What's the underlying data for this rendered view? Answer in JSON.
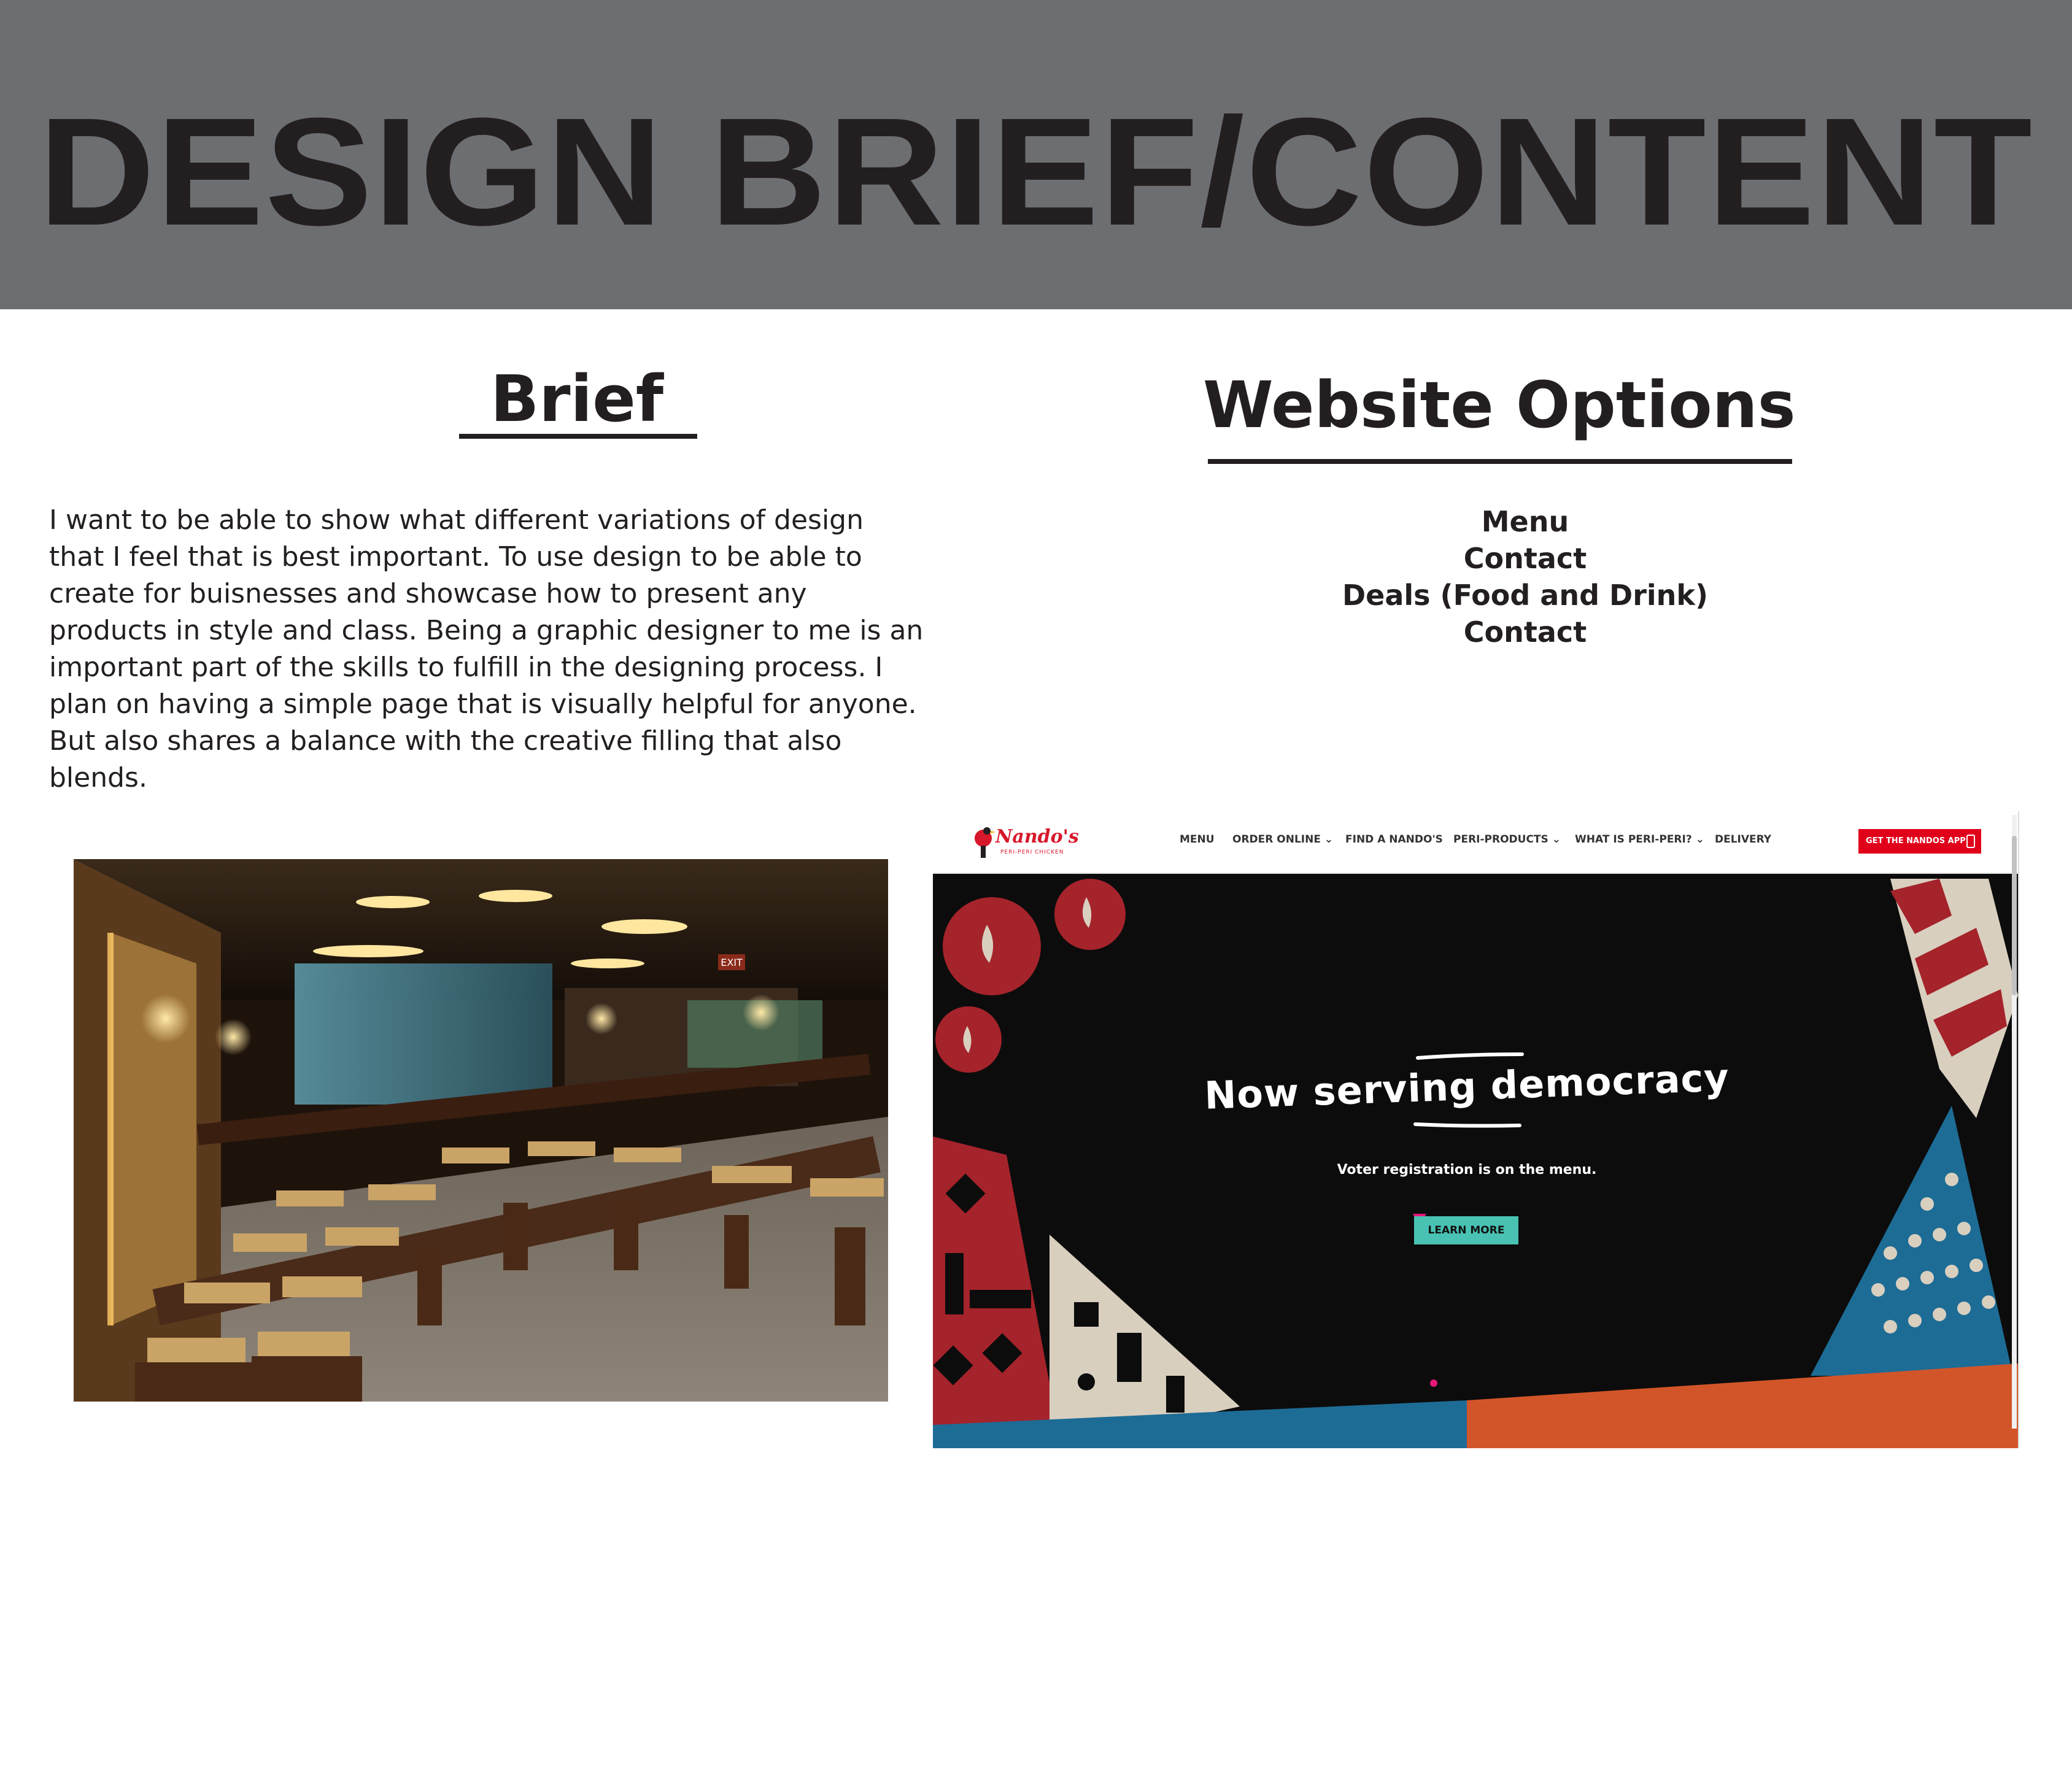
{
  "header": {
    "title": "DESIGN BRIEF/CONTENT",
    "background": "#6d6e71"
  },
  "brief": {
    "title": "Brief",
    "text": "I want to be able to show what different variations of design that I feel that is best important. To use design to be able to create for buisnesses and showcase how to present any products in style and class. Being a graphic designer to me is an important part of the skills to fulfill in the designing process. I plan on having a simple page that is visually helpful for anyone. But also shares a balance with the creative filling that also blends."
  },
  "website_options": {
    "title": "Website Options",
    "items": [
      "Menu",
      "Contact",
      "Deals (Food and Drink)",
      "Contact"
    ]
  },
  "restaurant_photo": {
    "icon": "restaurant-interior-photo",
    "exit_sign": "EXIT"
  },
  "site_screenshot": {
    "logo": "Nando's",
    "logo_tagline": "PERI-PERI CHICKEN",
    "nav": [
      "MENU",
      "ORDER ONLINE ⌄",
      "FIND A NANDO'S",
      "PERI-PRODUCTS ⌄",
      "WHAT IS PERI-PERI? ⌄",
      "DELIVERY"
    ],
    "app_button": "GET THE NANDOS APP",
    "hero_title": "Now serving democracy",
    "hero_subtitle": "Voter registration is on the menu.",
    "cta": "LEARN MORE",
    "colors": {
      "brand_red": "#d7182a",
      "hero_bg": "#0c0c0c",
      "cta": "#49c2b3",
      "pattern_red": "#a5232b",
      "pattern_blue": "#1d6c95",
      "pattern_orange": "#d2552a",
      "pattern_beige": "#d9cfbf"
    }
  }
}
